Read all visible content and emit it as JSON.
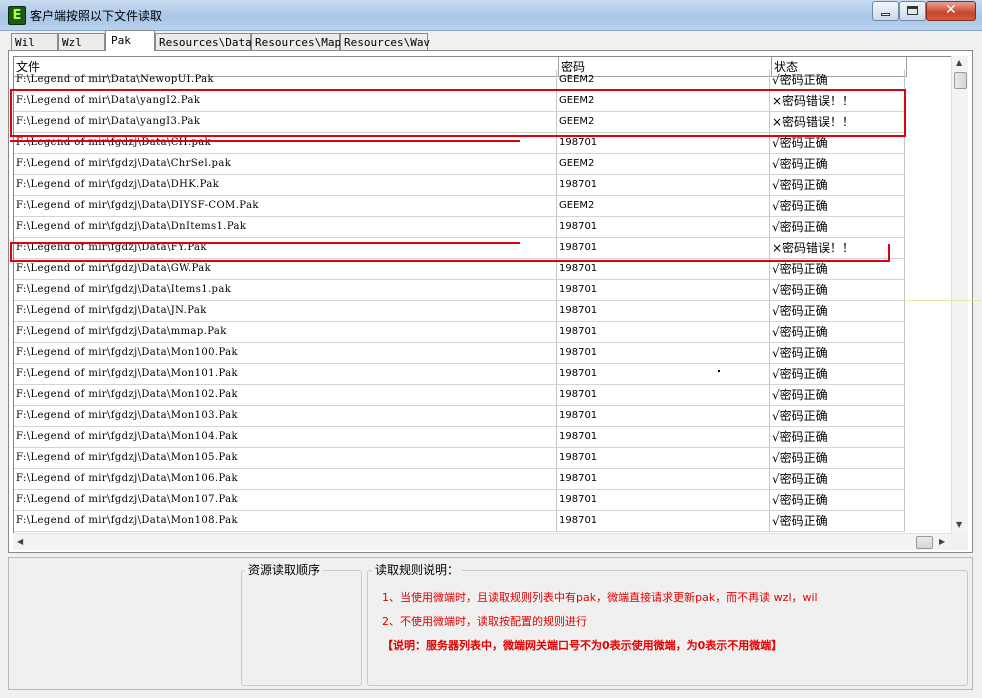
{
  "window": {
    "title": "客户端按照以下文件读取",
    "app_icon": "E",
    "controls": {
      "min_icon": "minimize-icon",
      "max_icon": "maximize-icon",
      "close_glyph": "✕"
    }
  },
  "tabs": [
    {
      "label": "Wil",
      "active": false
    },
    {
      "label": "Wzl",
      "active": false
    },
    {
      "label": "Pak",
      "active": true
    },
    {
      "label": "Resources\\Data",
      "active": false
    },
    {
      "label": "Resources\\Map",
      "active": false
    },
    {
      "label": "Resources\\Wav",
      "active": false
    }
  ],
  "table": {
    "headers": {
      "file": "文件",
      "password": "密码",
      "status": "状态"
    },
    "rows": [
      {
        "file": "F:\\Legend of mir\\Data\\NewopUI.Pak",
        "password": "GEEM2",
        "status": "√密码正确"
      },
      {
        "file": "F:\\Legend of mir\\Data\\yangI2.Pak",
        "password": "GEEM2",
        "status": "×密码错误！！"
      },
      {
        "file": "F:\\Legend of mir\\Data\\yangI3.Pak",
        "password": "GEEM2",
        "status": "×密码错误！！"
      },
      {
        "file": "F:\\Legend of mir\\fgdzj\\Data\\CH.pak",
        "password": "198701",
        "status": "√密码正确"
      },
      {
        "file": "F:\\Legend of mir\\fgdzj\\Data\\ChrSel.pak",
        "password": "GEEM2",
        "status": "√密码正确"
      },
      {
        "file": "F:\\Legend of mir\\fgdzj\\Data\\DHK.Pak",
        "password": "198701",
        "status": "√密码正确"
      },
      {
        "file": "F:\\Legend of mir\\fgdzj\\Data\\DIYSF-COM.Pak",
        "password": "GEEM2",
        "status": "√密码正确"
      },
      {
        "file": "F:\\Legend of mir\\fgdzj\\Data\\DnItems1.Pak",
        "password": "198701",
        "status": "√密码正确"
      },
      {
        "file": "F:\\Legend of mir\\fgdzj\\Data\\FY.Pak",
        "password": "198701",
        "status": "×密码错误！！"
      },
      {
        "file": "F:\\Legend of mir\\fgdzj\\Data\\GW.Pak",
        "password": "198701",
        "status": "√密码正确"
      },
      {
        "file": "F:\\Legend of mir\\fgdzj\\Data\\Items1.pak",
        "password": "198701",
        "status": "√密码正确"
      },
      {
        "file": "F:\\Legend of mir\\fgdzj\\Data\\JN.Pak",
        "password": "198701",
        "status": "√密码正确"
      },
      {
        "file": "F:\\Legend of mir\\fgdzj\\Data\\mmap.Pak",
        "password": "198701",
        "status": "√密码正确"
      },
      {
        "file": "F:\\Legend of mir\\fgdzj\\Data\\Mon100.Pak",
        "password": "198701",
        "status": "√密码正确"
      },
      {
        "file": "F:\\Legend of mir\\fgdzj\\Data\\Mon101.Pak",
        "password": "198701",
        "status": "√密码正确"
      },
      {
        "file": "F:\\Legend of mir\\fgdzj\\Data\\Mon102.Pak",
        "password": "198701",
        "status": "√密码正确"
      },
      {
        "file": "F:\\Legend of mir\\fgdzj\\Data\\Mon103.Pak",
        "password": "198701",
        "status": "√密码正确"
      },
      {
        "file": "F:\\Legend of mir\\fgdzj\\Data\\Mon104.Pak",
        "password": "198701",
        "status": "√密码正确"
      },
      {
        "file": "F:\\Legend of mir\\fgdzj\\Data\\Mon105.Pak",
        "password": "198701",
        "status": "√密码正确"
      },
      {
        "file": "F:\\Legend of mir\\fgdzj\\Data\\Mon106.Pak",
        "password": "198701",
        "status": "√密码正确"
      },
      {
        "file": "F:\\Legend of mir\\fgdzj\\Data\\Mon107.Pak",
        "password": "198701",
        "status": "√密码正确"
      },
      {
        "file": "F:\\Legend of mir\\fgdzj\\Data\\Mon108.Pak",
        "password": "198701",
        "status": "√密码正确"
      }
    ]
  },
  "scrollbars": {
    "up": "▲",
    "down": "▼",
    "left": "◀",
    "right": "▶"
  },
  "annotation_color": "#e1000f",
  "bottom": {
    "order_title": "资源读取顺序",
    "rules_title": "读取规则说明：",
    "rule1": "1、当使用微端时，且读取规则列表中有pak，微端直接请求更新pak，而不再读 wzl，wil",
    "rule2": "2、不使用微端时，读取按配置的规则进行",
    "rule3": "【说明：服务器列表中，微端网关端口号不为0表示使用微端，为0表示不用微端】"
  }
}
